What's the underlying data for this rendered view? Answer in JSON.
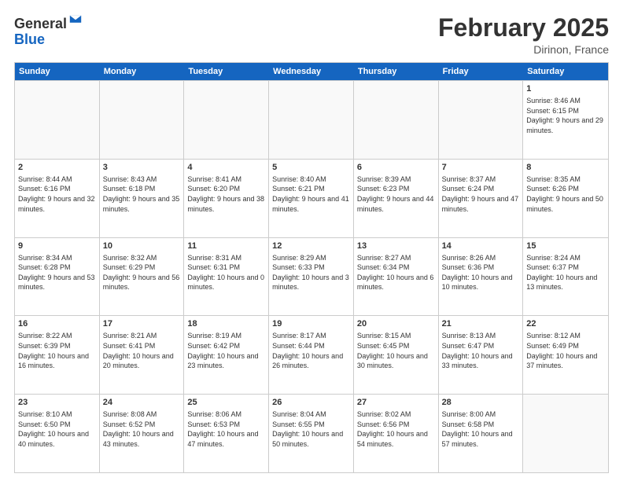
{
  "logo": {
    "general": "General",
    "blue": "Blue"
  },
  "title": "February 2025",
  "location": "Dirinon, France",
  "days": [
    "Sunday",
    "Monday",
    "Tuesday",
    "Wednesday",
    "Thursday",
    "Friday",
    "Saturday"
  ],
  "rows": [
    [
      {
        "day": "",
        "text": ""
      },
      {
        "day": "",
        "text": ""
      },
      {
        "day": "",
        "text": ""
      },
      {
        "day": "",
        "text": ""
      },
      {
        "day": "",
        "text": ""
      },
      {
        "day": "",
        "text": ""
      },
      {
        "day": "1",
        "text": "Sunrise: 8:46 AM\nSunset: 6:15 PM\nDaylight: 9 hours and 29 minutes."
      }
    ],
    [
      {
        "day": "2",
        "text": "Sunrise: 8:44 AM\nSunset: 6:16 PM\nDaylight: 9 hours and 32 minutes."
      },
      {
        "day": "3",
        "text": "Sunrise: 8:43 AM\nSunset: 6:18 PM\nDaylight: 9 hours and 35 minutes."
      },
      {
        "day": "4",
        "text": "Sunrise: 8:41 AM\nSunset: 6:20 PM\nDaylight: 9 hours and 38 minutes."
      },
      {
        "day": "5",
        "text": "Sunrise: 8:40 AM\nSunset: 6:21 PM\nDaylight: 9 hours and 41 minutes."
      },
      {
        "day": "6",
        "text": "Sunrise: 8:39 AM\nSunset: 6:23 PM\nDaylight: 9 hours and 44 minutes."
      },
      {
        "day": "7",
        "text": "Sunrise: 8:37 AM\nSunset: 6:24 PM\nDaylight: 9 hours and 47 minutes."
      },
      {
        "day": "8",
        "text": "Sunrise: 8:35 AM\nSunset: 6:26 PM\nDaylight: 9 hours and 50 minutes."
      }
    ],
    [
      {
        "day": "9",
        "text": "Sunrise: 8:34 AM\nSunset: 6:28 PM\nDaylight: 9 hours and 53 minutes."
      },
      {
        "day": "10",
        "text": "Sunrise: 8:32 AM\nSunset: 6:29 PM\nDaylight: 9 hours and 56 minutes."
      },
      {
        "day": "11",
        "text": "Sunrise: 8:31 AM\nSunset: 6:31 PM\nDaylight: 10 hours and 0 minutes."
      },
      {
        "day": "12",
        "text": "Sunrise: 8:29 AM\nSunset: 6:33 PM\nDaylight: 10 hours and 3 minutes."
      },
      {
        "day": "13",
        "text": "Sunrise: 8:27 AM\nSunset: 6:34 PM\nDaylight: 10 hours and 6 minutes."
      },
      {
        "day": "14",
        "text": "Sunrise: 8:26 AM\nSunset: 6:36 PM\nDaylight: 10 hours and 10 minutes."
      },
      {
        "day": "15",
        "text": "Sunrise: 8:24 AM\nSunset: 6:37 PM\nDaylight: 10 hours and 13 minutes."
      }
    ],
    [
      {
        "day": "16",
        "text": "Sunrise: 8:22 AM\nSunset: 6:39 PM\nDaylight: 10 hours and 16 minutes."
      },
      {
        "day": "17",
        "text": "Sunrise: 8:21 AM\nSunset: 6:41 PM\nDaylight: 10 hours and 20 minutes."
      },
      {
        "day": "18",
        "text": "Sunrise: 8:19 AM\nSunset: 6:42 PM\nDaylight: 10 hours and 23 minutes."
      },
      {
        "day": "19",
        "text": "Sunrise: 8:17 AM\nSunset: 6:44 PM\nDaylight: 10 hours and 26 minutes."
      },
      {
        "day": "20",
        "text": "Sunrise: 8:15 AM\nSunset: 6:45 PM\nDaylight: 10 hours and 30 minutes."
      },
      {
        "day": "21",
        "text": "Sunrise: 8:13 AM\nSunset: 6:47 PM\nDaylight: 10 hours and 33 minutes."
      },
      {
        "day": "22",
        "text": "Sunrise: 8:12 AM\nSunset: 6:49 PM\nDaylight: 10 hours and 37 minutes."
      }
    ],
    [
      {
        "day": "23",
        "text": "Sunrise: 8:10 AM\nSunset: 6:50 PM\nDaylight: 10 hours and 40 minutes."
      },
      {
        "day": "24",
        "text": "Sunrise: 8:08 AM\nSunset: 6:52 PM\nDaylight: 10 hours and 43 minutes."
      },
      {
        "day": "25",
        "text": "Sunrise: 8:06 AM\nSunset: 6:53 PM\nDaylight: 10 hours and 47 minutes."
      },
      {
        "day": "26",
        "text": "Sunrise: 8:04 AM\nSunset: 6:55 PM\nDaylight: 10 hours and 50 minutes."
      },
      {
        "day": "27",
        "text": "Sunrise: 8:02 AM\nSunset: 6:56 PM\nDaylight: 10 hours and 54 minutes."
      },
      {
        "day": "28",
        "text": "Sunrise: 8:00 AM\nSunset: 6:58 PM\nDaylight: 10 hours and 57 minutes."
      },
      {
        "day": "",
        "text": ""
      }
    ]
  ]
}
